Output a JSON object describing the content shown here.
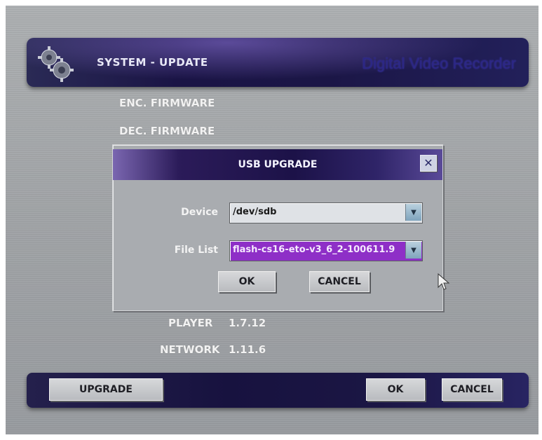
{
  "header": {
    "title": "SYSTEM - UPDATE",
    "brand": "Digital Video Recorder",
    "icon": "gears-icon"
  },
  "info": {
    "enc_firmware_label": "ENC. FIRMWARE",
    "dec_firmware_label": "DEC. FIRMWARE",
    "player_label": "PLAYER",
    "player_value": "1.7.12",
    "network_label": "NETWORK",
    "network_value": "1.11.6"
  },
  "dialog": {
    "title": "USB UPGRADE",
    "close_symbol": "✕",
    "device_label": "Device",
    "device_value": "/dev/sdb",
    "file_list_label": "File List",
    "file_list_value": "flash-cs16-eto-v3_6_2-100611.9",
    "ok_label": "OK",
    "cancel_label": "CANCEL"
  },
  "footer": {
    "upgrade_label": "UPGRADE",
    "ok_label": "OK",
    "cancel_label": "CANCEL"
  },
  "colors": {
    "accent_purple": "#8e2fc7",
    "header_navy": "#1a1445",
    "screen_gray": "#a2a5a8"
  }
}
